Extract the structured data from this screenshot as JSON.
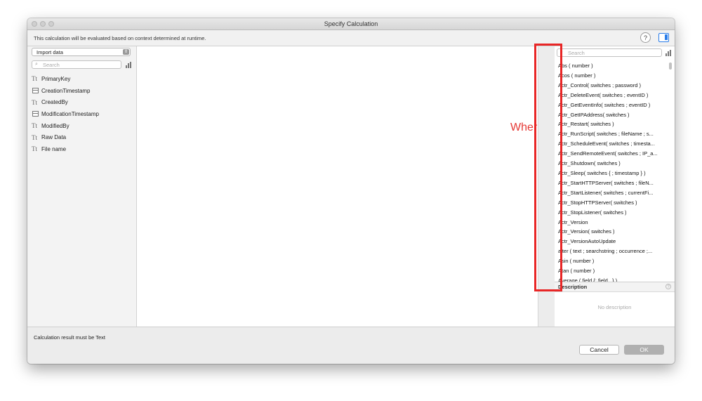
{
  "window": {
    "title": "Specify Calculation",
    "info_text": "This calculation will be evaluated based on context determined at runtime.",
    "help_label": "?",
    "accent": "#2b7de9"
  },
  "left_panel": {
    "dropdown_value": "Import data",
    "search_placeholder": "Search",
    "fields": [
      {
        "icon": "text-field-icon",
        "glyph": "Tt",
        "name": "PrimaryKey"
      },
      {
        "icon": "timestamp-field-icon",
        "glyph": "",
        "name": "CreationTimestamp"
      },
      {
        "icon": "text-field-icon",
        "glyph": "Tt",
        "name": "CreatedBy"
      },
      {
        "icon": "timestamp-field-icon",
        "glyph": "",
        "name": "ModificationTimestamp"
      },
      {
        "icon": "text-field-icon",
        "glyph": "Tt",
        "name": "ModifiedBy"
      },
      {
        "icon": "text-field-icon",
        "glyph": "Tt",
        "name": "Raw Data"
      },
      {
        "icon": "text-field-icon",
        "glyph": "Tt",
        "name": "File name"
      }
    ]
  },
  "editor": {
    "annotation": "Where did all these go?",
    "annotation_color": "#e53935"
  },
  "right_panel": {
    "search_placeholder": "Search",
    "functions": [
      "Abs ( number )",
      "Acos ( number )",
      "Actr_Control( switches ; password )",
      "Actr_DeleteEvent( switches ; eventID )",
      "Actr_GetEventInfo( switches ; eventID )",
      "Actr_GetIPAddress( switches )",
      "Actr_Restart( switches )",
      "Actr_RunScript( switches ; fileName ; s...",
      "Actr_ScheduleEvent( switches ; timesta...",
      "Actr_SendRemoteEvent( switches ; IP_a...",
      "Actr_Shutdown( switches )",
      "Actr_Sleep( switches { ; timestamp } )",
      "Actr_StartHTTPServer( switches ; fileN...",
      "Actr_StartListener( switches ; currentFi...",
      "Actr_StopHTTPServer( switches )",
      "Actr_StopListener( switches )",
      "Actr_Version",
      "Actr_Version( switches )",
      "Actr_VersionAutoUpdate",
      "alter ( text ; searchstring ; occurrence ;...",
      "Asin ( number )",
      "Atan ( number )",
      "Average ( field {; field...} )"
    ],
    "description_label": "Description",
    "description_help": "?",
    "no_description": "No description"
  },
  "footer": {
    "result_label": "Calculation result must be  Text",
    "cancel_label": "Cancel",
    "ok_label": "OK"
  },
  "highlight_color": "#e82626"
}
